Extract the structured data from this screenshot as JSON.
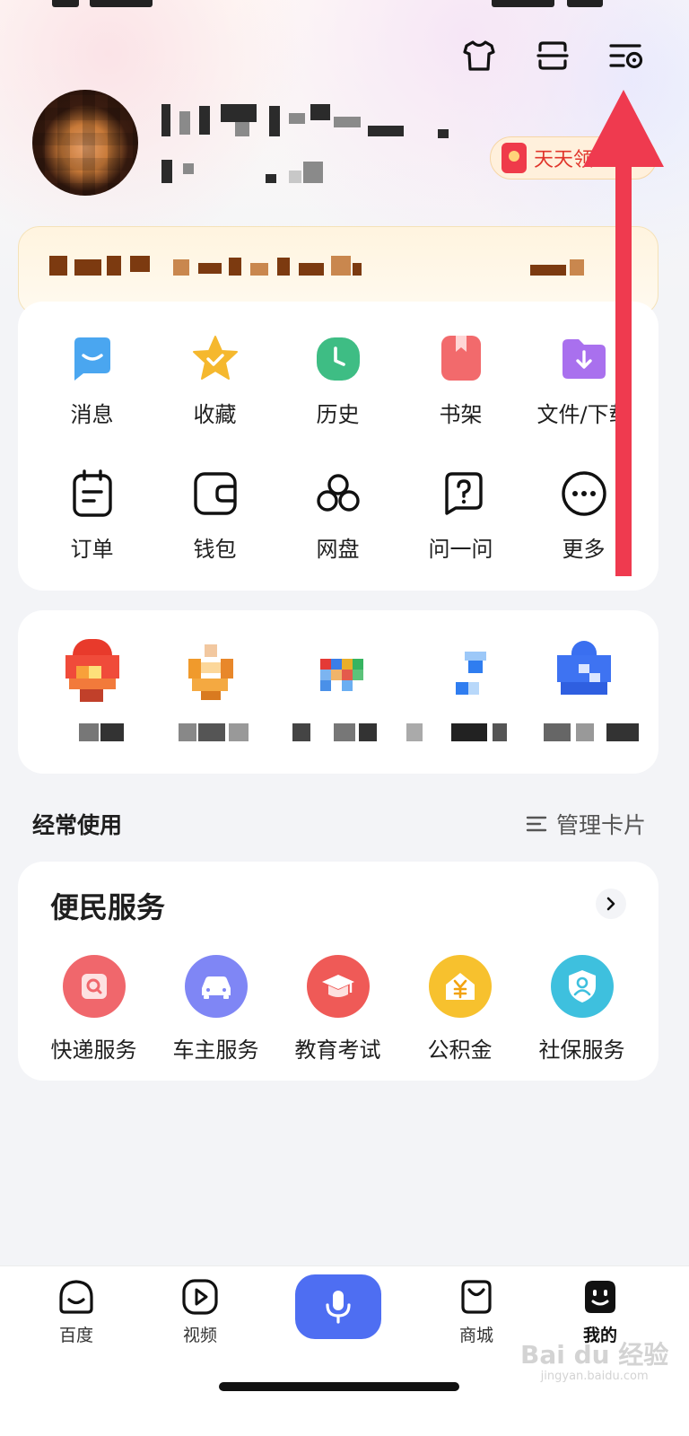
{
  "colors": {
    "accent_blue": "#4e6ef2",
    "annotation_red": "#ef3a4f",
    "red_packet_text": "#e0352b"
  },
  "header": {
    "icons": [
      "skin-icon",
      "scan-icon",
      "settings-icon"
    ],
    "red_packet_label": "天天领"
  },
  "shortcuts": {
    "row1": [
      {
        "label": "消息",
        "icon": "message-icon"
      },
      {
        "label": "收藏",
        "icon": "star-icon"
      },
      {
        "label": "历史",
        "icon": "history-icon"
      },
      {
        "label": "书架",
        "icon": "bookshelf-icon"
      },
      {
        "label": "文件/下载",
        "icon": "download-folder-icon"
      }
    ],
    "row2": [
      {
        "label": "订单",
        "icon": "order-icon"
      },
      {
        "label": "钱包",
        "icon": "wallet-icon"
      },
      {
        "label": "网盘",
        "icon": "cloud-drive-icon"
      },
      {
        "label": "问一问",
        "icon": "ask-icon"
      },
      {
        "label": "更多",
        "icon": "more-icon"
      }
    ]
  },
  "frequent": {
    "title": "经常使用",
    "manage_label": "管理卡片"
  },
  "services": {
    "title": "便民服务",
    "items": [
      {
        "label": "快递服务",
        "icon": "express-icon",
        "color": "#f0676c"
      },
      {
        "label": "车主服务",
        "icon": "car-icon",
        "color": "#7f86f5"
      },
      {
        "label": "教育考试",
        "icon": "graduation-cap-icon",
        "color": "#ef5a57"
      },
      {
        "label": "公积金",
        "icon": "housing-fund-icon",
        "color": "#f7c12e"
      },
      {
        "label": "社保服务",
        "icon": "social-security-icon",
        "color": "#3ec0de"
      }
    ]
  },
  "tabbar": {
    "tabs": [
      {
        "label": "百度",
        "icon": "baidu-home-icon"
      },
      {
        "label": "视频",
        "icon": "video-icon"
      },
      {
        "label": "",
        "icon": "microphone-icon"
      },
      {
        "label": "商城",
        "icon": "shop-bag-icon"
      },
      {
        "label": "我的",
        "icon": "profile-face-icon"
      }
    ]
  },
  "watermark": {
    "text": "Bai du 经验",
    "url": "jingyan.baidu.com"
  }
}
